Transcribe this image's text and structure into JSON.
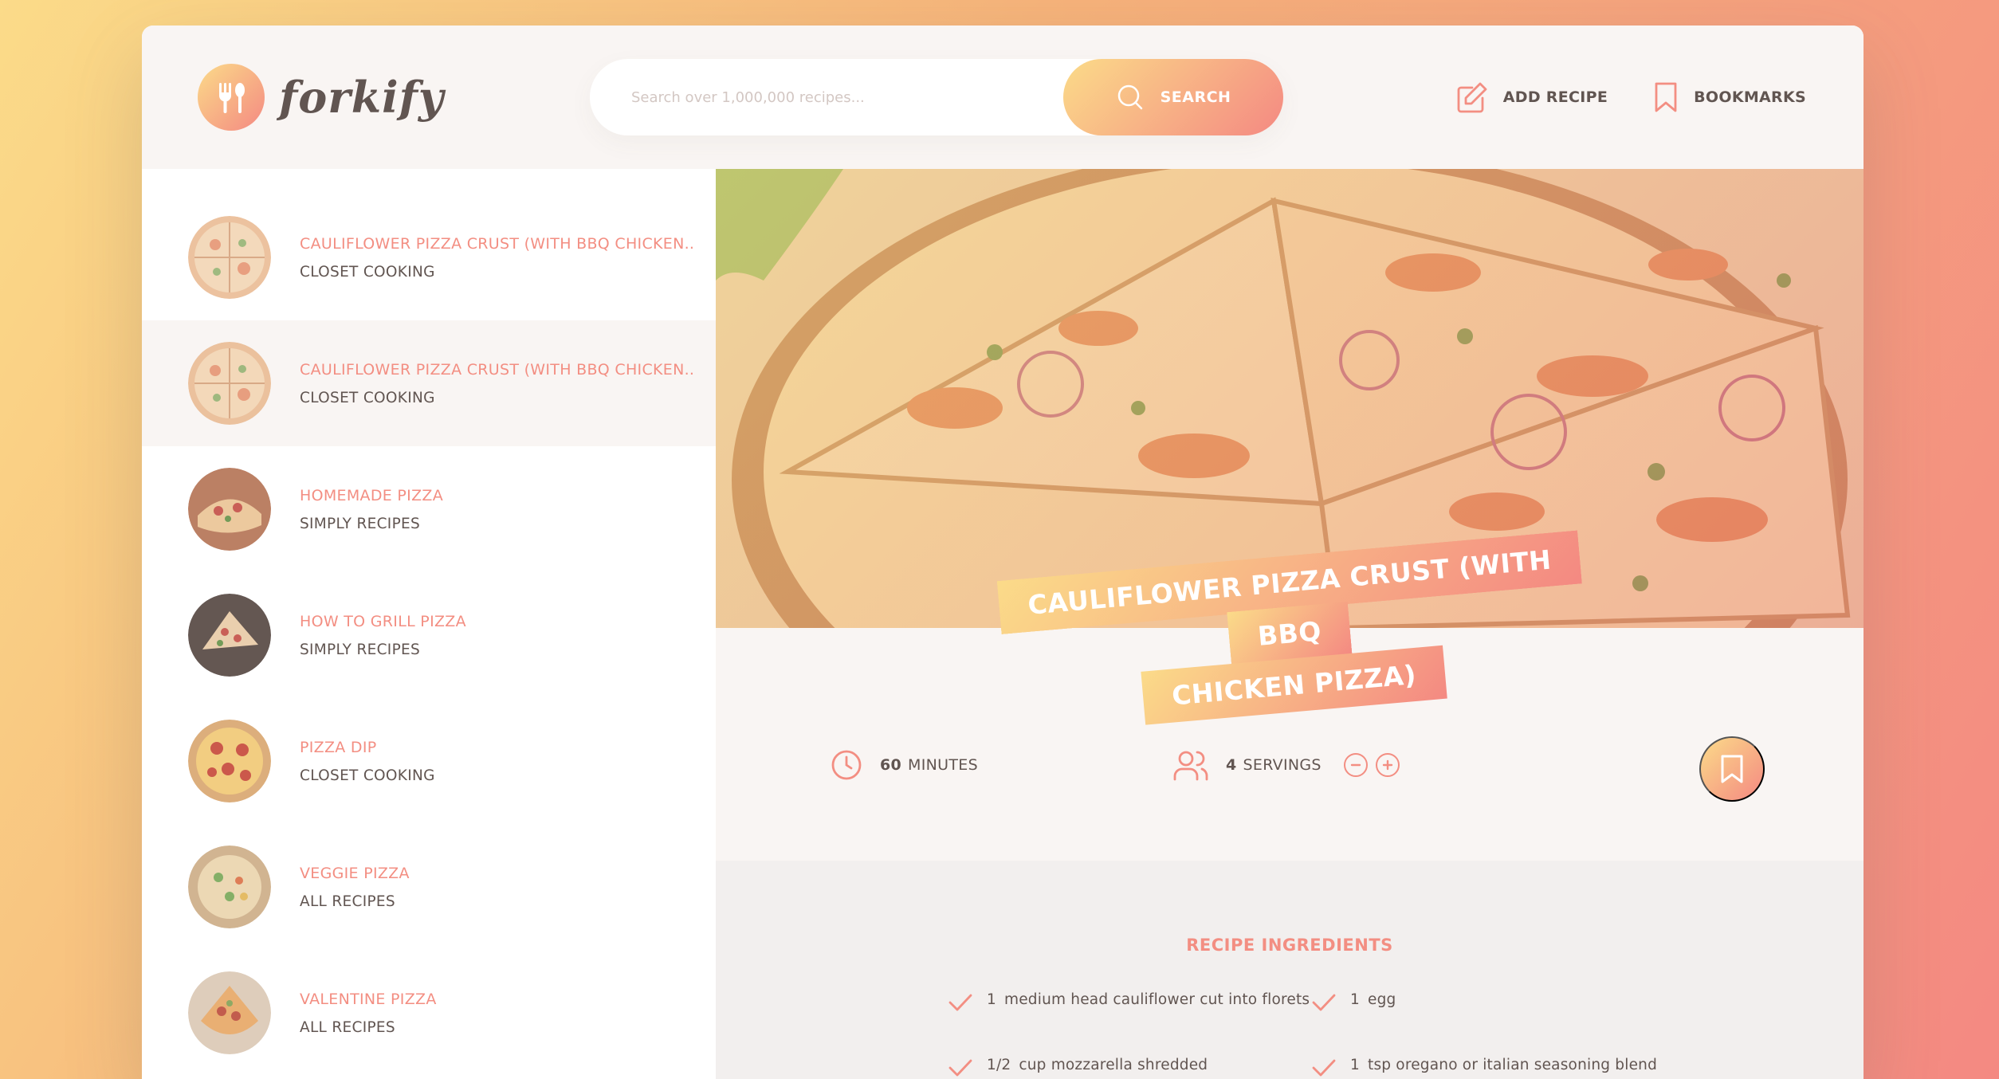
{
  "header": {
    "logo_text": "forkify",
    "search_placeholder": "Search over 1,000,000 recipes...",
    "search_button": "SEARCH",
    "nav": {
      "add_recipe": "ADD RECIPE",
      "bookmarks": "BOOKMARKS"
    }
  },
  "results": [
    {
      "title": "CAULIFLOWER PIZZA CRUST (WITH BBQ CHICKEN..",
      "publisher": "CLOSET COOKING",
      "active": false
    },
    {
      "title": "CAULIFLOWER PIZZA CRUST (WITH BBQ CHICKEN..",
      "publisher": "CLOSET COOKING",
      "active": true
    },
    {
      "title": "HOMEMADE PIZZA",
      "publisher": "SIMPLY RECIPES",
      "active": false
    },
    {
      "title": "HOW TO GRILL PIZZA",
      "publisher": "SIMPLY RECIPES",
      "active": false
    },
    {
      "title": "PIZZA DIP",
      "publisher": "CLOSET COOKING",
      "active": false
    },
    {
      "title": "VEGGIE PIZZA",
      "publisher": "ALL RECIPES",
      "active": false
    },
    {
      "title": "VALENTINE PIZZA",
      "publisher": "ALL RECIPES",
      "active": false
    }
  ],
  "recipe": {
    "title_line1": "CAULIFLOWER PIZZA CRUST (WITH BBQ",
    "title_line2": "CHICKEN PIZZA)",
    "minutes": "60",
    "minutes_label": "MINUTES",
    "servings": "4",
    "servings_label": "SERVINGS",
    "decrease_icon": "minus-circle-icon",
    "increase_icon": "plus-circle-icon",
    "ingredients_heading": "RECIPE INGREDIENTS",
    "ingredients": [
      {
        "qty": "1",
        "desc": "medium head cauliflower cut into florets"
      },
      {
        "qty": "1",
        "desc": "egg"
      },
      {
        "qty": "1/2",
        "desc": "cup mozzarella shredded"
      },
      {
        "qty": "1",
        "desc": "tsp oregano or italian seasoning blend"
      }
    ]
  },
  "colors": {
    "accent_start": "#fbdb89",
    "accent_end": "#f48982",
    "accent_text": "#f38e82",
    "text": "#615551"
  }
}
